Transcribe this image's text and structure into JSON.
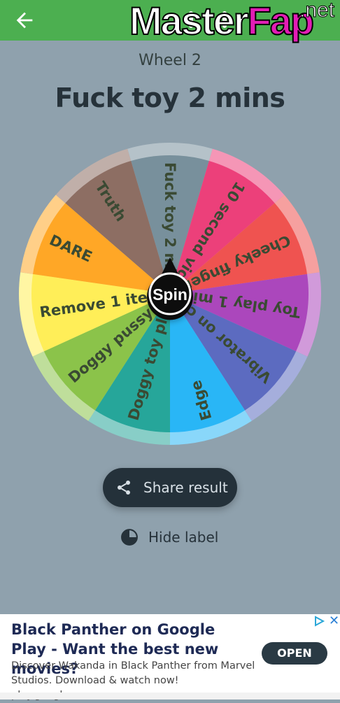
{
  "watermark": {
    "main": "Master",
    "accent": "Fap",
    "suffix": ".net"
  },
  "header": {
    "wheel_name": "Wheel 2",
    "result": "Fuck toy 2 mins"
  },
  "wheel": {
    "segments": [
      {
        "label": "Fuck toy 2 mins",
        "color": "#78909c"
      },
      {
        "label": "10 second vid",
        "color": "#ec407a"
      },
      {
        "label": "Cheeky finger",
        "color": "#ef5350"
      },
      {
        "label": "Toy play 1 min",
        "color": "#ab47bc"
      },
      {
        "label": "Vibrator on clit",
        "color": "#5c6bc0"
      },
      {
        "label": "Edge",
        "color": "#29b6f6"
      },
      {
        "label": "Doggy toy play",
        "color": "#26a69a"
      },
      {
        "label": "Doggy pussy fuck",
        "color": "#8bc34a"
      },
      {
        "label": "Remove 1 item",
        "color": "#ffee58"
      },
      {
        "label": "DARE",
        "color": "#ffa726"
      },
      {
        "label": "Truth",
        "color": "#8d6e63"
      }
    ],
    "spin_label": "Spin",
    "text_color": "#3a4a33"
  },
  "share": {
    "label": "Share result"
  },
  "hide": {
    "label": "Hide label"
  },
  "ad": {
    "title": "Black Panther on Google Play - Want the best new movies?",
    "description": "Discover Wakanda in Black Panther from Marvel Studios. Download & watch now! play.google.com",
    "cta": "OPEN",
    "close": "✕"
  },
  "colors": {
    "topbar": "#4caf50",
    "background": "#8fa1ad",
    "button": "#24313a"
  }
}
